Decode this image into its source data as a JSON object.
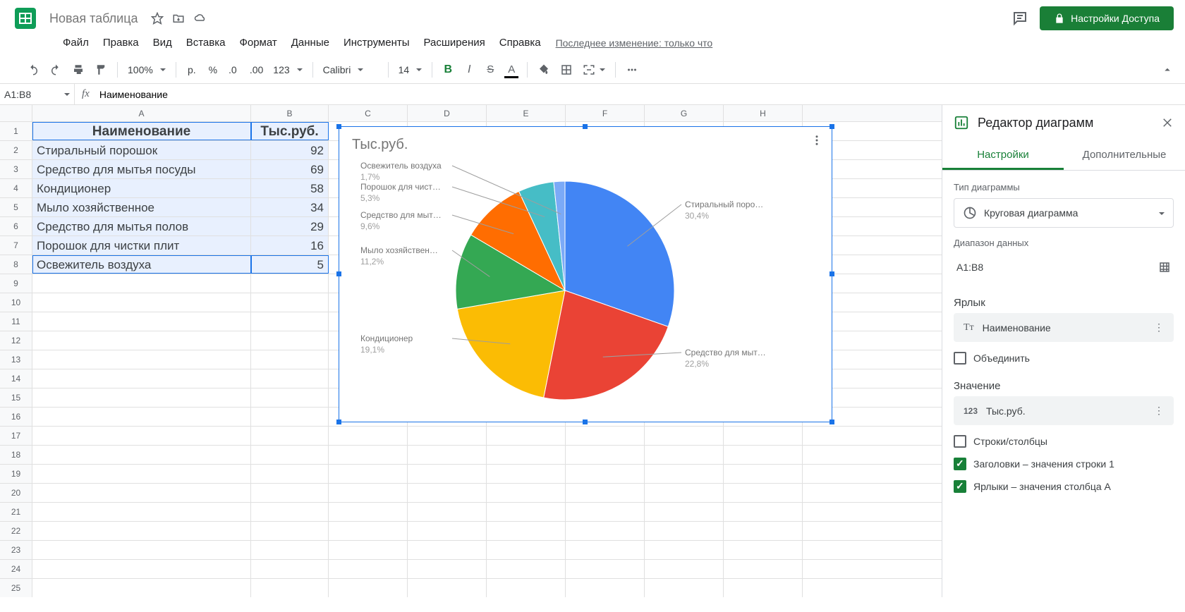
{
  "doc": {
    "title": "Новая таблица"
  },
  "menu": [
    "Файл",
    "Правка",
    "Вид",
    "Вставка",
    "Формат",
    "Данные",
    "Инструменты",
    "Расширения",
    "Справка"
  ],
  "last_edit": "Последнее изменение: только что",
  "share_btn": "Настройки Доступа",
  "toolbar": {
    "zoom": "100%",
    "currency": "р.",
    "font": "Calibri",
    "size": "14"
  },
  "name_box": "A1:B8",
  "formula": "Наименование",
  "columns": [
    "A",
    "B",
    "C",
    "D",
    "E",
    "F",
    "G",
    "H"
  ],
  "table": {
    "header": [
      "Наименование",
      "Тыс.руб."
    ],
    "rows": [
      [
        "Стиральный порошок",
        "92"
      ],
      [
        "Средство для мытья посуды",
        "69"
      ],
      [
        "Кондиционер",
        "58"
      ],
      [
        "Мыло хозяйственное",
        "34"
      ],
      [
        "Средство для мытья полов",
        "29"
      ],
      [
        "Порошок для чистки плит",
        "16"
      ],
      [
        "Освежитель воздуха",
        "5"
      ]
    ]
  },
  "chart_data": {
    "type": "pie",
    "title": "Тыс.руб.",
    "categories": [
      "Стиральный порошок",
      "Средство для мытья посуды",
      "Кондиционер",
      "Мыло хозяйственное",
      "Средство для мытья полов",
      "Порошок для чистки плит",
      "Освежитель воздуха"
    ],
    "values": [
      92,
      69,
      58,
      34,
      29,
      16,
      5
    ],
    "percent_labels": [
      "30,4%",
      "22,8%",
      "19,1%",
      "11,2%",
      "9,6%",
      "5,3%",
      "1,7%"
    ],
    "display_labels": [
      "Стиральный поро…",
      "Средство для мыт…",
      "Кондиционер",
      "Мыло хозяйствен…",
      "Средство для мыт…",
      "Порошок для чист…",
      "Освежитель воздуха"
    ],
    "colors": [
      "#4285f4",
      "#ea4335",
      "#fbbc04",
      "#34a853",
      "#ff6d01",
      "#46bdc6",
      "#7baaf7"
    ]
  },
  "editor": {
    "title": "Редактор диаграмм",
    "tab_setup": "Настройки",
    "tab_customize": "Дополнительные",
    "chart_type_label": "Тип диаграммы",
    "chart_type_value": "Круговая диаграмма",
    "data_range_label": "Диапазон данных",
    "data_range_value": "A1:B8",
    "label_section": "Ярлык",
    "label_chip": "Наименование",
    "aggregate": "Объединить",
    "value_section": "Значение",
    "value_chip": "Тыс.руб.",
    "switch_rc": "Строки/столбцы",
    "use_row1": "Заголовки – значения строки 1",
    "use_colA": "Ярлыки – значения столбца A"
  }
}
